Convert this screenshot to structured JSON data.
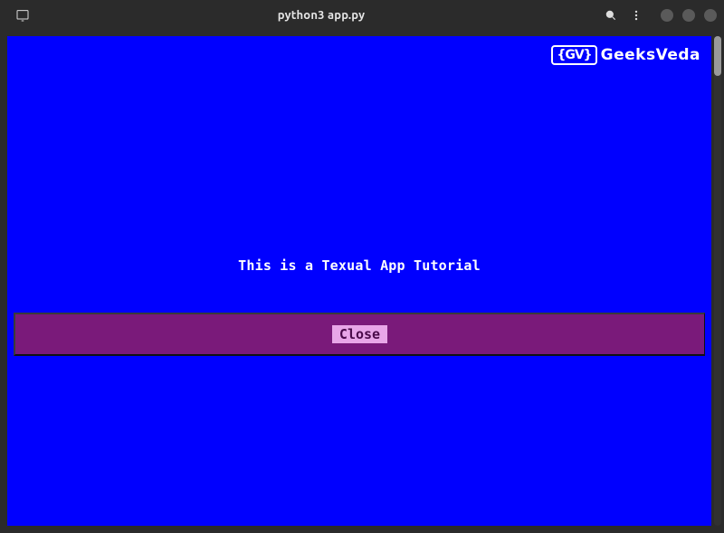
{
  "titlebar": {
    "title": "python3 app.py"
  },
  "logo": {
    "badge": "{GV}",
    "text": "GeeksVeda"
  },
  "main": {
    "heading": "This is a Texual App Tutorial"
  },
  "button": {
    "label": "Close"
  }
}
